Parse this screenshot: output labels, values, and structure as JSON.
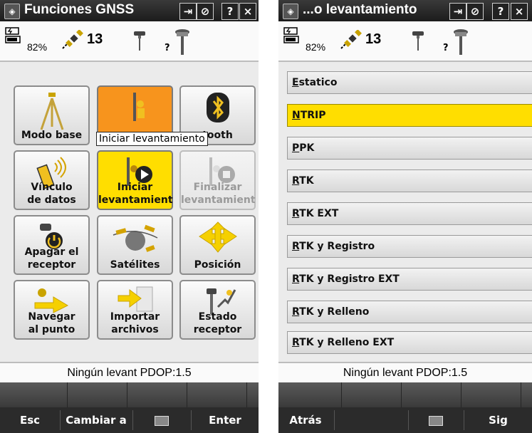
{
  "left": {
    "title": "Funciones GNSS",
    "title_buttons": [
      "⇥",
      "⊘",
      "?",
      "×"
    ],
    "battery_pct": "82%",
    "satellites": "13",
    "antenna_q": "?",
    "tiles": [
      {
        "label": "Modo base"
      },
      {
        "label": ""
      },
      {
        "label": "tooth"
      },
      {
        "label": "Vínculo\nde datos"
      },
      {
        "label": "Iniciar\nlevantamient"
      },
      {
        "label": "Finalizar\nlevantamient"
      },
      {
        "label": "Apagar el\nreceptor"
      },
      {
        "label": "Satélites"
      },
      {
        "label": "Posición"
      },
      {
        "label": "Navegar\nal punto"
      },
      {
        "label": "Importar\narchivos"
      },
      {
        "label": "Estado\nreceptor"
      }
    ],
    "tooltip": "Iniciar levantamiento",
    "footer_status": "Ningún levant  PDOP:1.5",
    "softkeys": [
      "Esc",
      "Cambiar a",
      "",
      "Enter"
    ]
  },
  "right": {
    "title": "...o levantamiento",
    "title_buttons": [
      "⇥",
      "⊘",
      "?",
      "×"
    ],
    "battery_pct": "82%",
    "satellites": "13",
    "antenna_q": "?",
    "items": [
      {
        "first": "E",
        "rest": "statico"
      },
      {
        "first": "N",
        "rest": "TRIP"
      },
      {
        "first": "P",
        "rest": "PK"
      },
      {
        "first": "R",
        "rest": "TK"
      },
      {
        "first": "R",
        "rest": "TK EXT"
      },
      {
        "first": "R",
        "rest": "TK y Registro"
      },
      {
        "first": "R",
        "rest": "TK y Registro EXT"
      },
      {
        "first": "R",
        "rest": "TK y Relleno"
      },
      {
        "first": "R",
        "rest": "TK y Relleno EXT"
      }
    ],
    "selected_index": 1,
    "footer_status": "Ningún levant  PDOP:1.5",
    "softkeys": [
      "Atrás",
      "",
      "Sig"
    ]
  },
  "colors": {
    "accent_yellow": "#ffde00",
    "accent_orange": "#f7941d",
    "titlebar": "#262626"
  }
}
